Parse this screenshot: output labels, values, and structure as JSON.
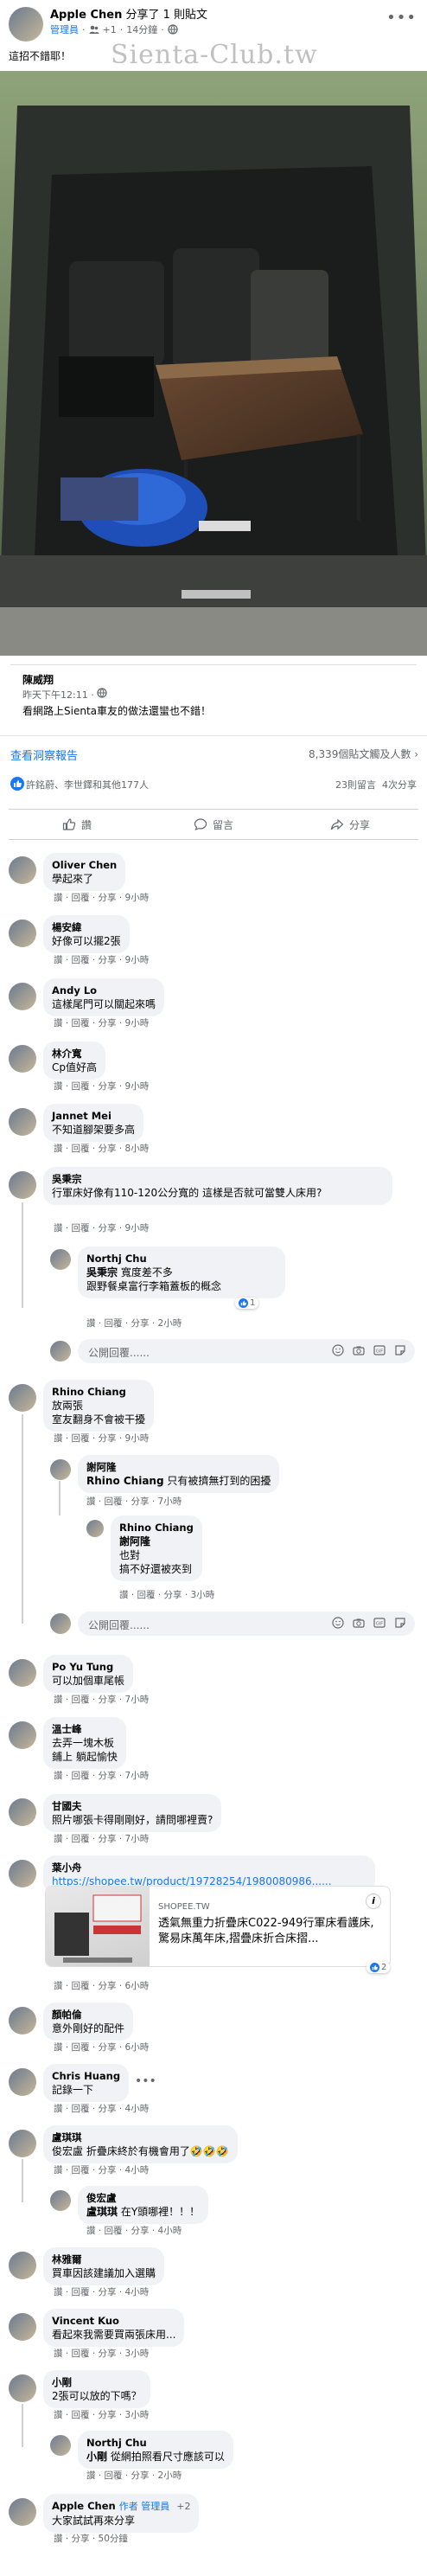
{
  "post": {
    "author": "Apple Chen",
    "action": "分享了 1 則貼文",
    "role": "管理員",
    "count_badge": "+1",
    "time": "14分鐘",
    "text": "這招不錯耶！",
    "watermark": "Sienta-Club.tw"
  },
  "shared": {
    "author": "陳威翔",
    "time": "昨天下午12:11 · ",
    "text": "看網路上Sienta車友的做法還蠻也不錯！"
  },
  "insights": {
    "link": "查看洞察報告",
    "reach": "8,339個貼文觸及人數"
  },
  "reactions": {
    "names": "許銘蔚、李世鐸和其他177人",
    "comments": "23則留言",
    "shares": "4次分享"
  },
  "actions": {
    "like": "讚",
    "comment": "留言",
    "share": "分享"
  },
  "reply_placeholder": "公開回覆......",
  "comments": [
    {
      "name": "Oliver Chen",
      "text": "學起來了",
      "meta_prefix": "讚 · 回覆 · 分享 · ",
      "time": "9小時"
    },
    {
      "name": "楊安緯",
      "text": "好像可以擺2張",
      "meta_prefix": "讚 · 回覆 · 分享 · ",
      "time": "9小時"
    },
    {
      "name": "Andy Lo",
      "text": "這樣尾門可以關起來嗎",
      "meta_prefix": "讚 · 回覆 · 分享 · ",
      "time": "9小時"
    },
    {
      "name": "林介寬",
      "text": "Cp值好高",
      "meta_prefix": "讚 · 回覆 · 分享 · ",
      "time": "9小時"
    },
    {
      "name": "Jannet Mei",
      "text": "不知道腳架要多高",
      "meta_prefix": "讚 · 回覆 · 分享 · ",
      "time": "8小時"
    },
    {
      "name": "吳秉宗",
      "text": "行軍床好像有110-120公分寬的 這樣是否就可當雙人床用?",
      "meta_prefix": "讚 · 回覆 · 分享 · ",
      "time": "9小時"
    },
    {
      "name": "Rhino Chiang",
      "text": "放兩張\n室友翻身不會被干擾",
      "meta_prefix": "讚 · 回覆 · 分享 · ",
      "time": "9小時"
    },
    {
      "name": "Po Yu Tung",
      "text": "可以加個車尾帳",
      "meta_prefix": "讚 · 回覆 · 分享 · ",
      "time": "7小時"
    },
    {
      "name": "溫士峰",
      "text": "去弄一塊木板\n鋪上 躺起愉快",
      "meta_prefix": "讚 · 回覆 · 分享 · ",
      "time": "7小時"
    },
    {
      "name": "甘國夫",
      "text": "照片哪張卡得剛剛好，請問哪裡賣?",
      "meta_prefix": "讚 · 回覆 · 分享 · ",
      "time": "7小時"
    },
    {
      "name": "葉小舟",
      "text": "https://shopee.tw/product/19728254/1980080986......",
      "meta_prefix": "讚 · 回覆 · 分享 · ",
      "time": "6小時"
    },
    {
      "name": "顏帕倫",
      "text": "意外剛好的配件",
      "meta_prefix": "讚 · 回覆 · 分享 · ",
      "time": "6小時"
    },
    {
      "name": "Chris Huang",
      "text": "記錄一下",
      "meta_prefix": "讚 · 回覆 · 分享 · ",
      "time": "4小時"
    },
    {
      "name": "盧琪琪",
      "text": "俊宏盧 折疊床終於有機會用了🤣🤣🤣",
      "meta_prefix": "讚 · 回覆 · 分享 · ",
      "time": "4小時"
    },
    {
      "name": "林雅爾",
      "text": "買車因該建議加入選購",
      "meta_prefix": "讚 · 回覆 · 分享 · ",
      "time": "4小時"
    },
    {
      "name": "Vincent Kuo",
      "text": "看起來我需要買兩張床用...",
      "meta_prefix": "讚 · 回覆 · 分享 · ",
      "time": "3小時"
    },
    {
      "name": "小剛",
      "text": "2張可以放的下嗎？",
      "meta_prefix": "讚 · 回覆 · 分享 · ",
      "time": "3小時"
    },
    {
      "name": "Apple Chen",
      "badges": "作者   管理員",
      "count": "+2",
      "text": "大家試試再來分享",
      "meta_prefix": "讚 · 分享 · ",
      "time": "50分鐘"
    }
  ],
  "replies": {
    "northju1": {
      "name": "Northj Chu",
      "mention": "吳秉宗",
      "text1": " 寬度差不多",
      "text2": "跟野餐桌富行李箱蓋板的概念",
      "meta_prefix": "讚 · 回覆 · 分享 · ",
      "time": "2小時",
      "react_count": "1"
    },
    "xie": {
      "name": "謝阿隆",
      "mention": "Rhino Chiang",
      "text": " 只有被擠無打到的困擾",
      "meta_prefix": "讚 · 回覆 · 分享 · ",
      "time": "7小時"
    },
    "rhino2": {
      "name": "Rhino Chiang",
      "mention": "謝阿隆",
      "text": "也對\n搞不好還被夾到",
      "meta_prefix": "讚 · 回覆 · 分享 · ",
      "time": "3小時"
    },
    "jun": {
      "name": "俊宏盧",
      "mention": "盧琪琪",
      "text": " 在Y頭哪裡！！！",
      "meta_prefix": "讚 · 回覆 · 分享 · ",
      "time": "4小時"
    },
    "northju2": {
      "name": "Northj Chu",
      "mention": "小剛",
      "text": " 從網拍照看尺寸應該可以",
      "meta_prefix": "讚 · 回覆 · 分享 · ",
      "time": "2小時"
    }
  },
  "link_preview": {
    "domain": "SHOPEE.TW",
    "title": "透氣無重力折疊床C022-949行軍床看護床,驚易床萬年床,摺疊床折合床摺...",
    "react_count": "2"
  },
  "colors": {
    "accent": "#1877f2",
    "bubble": "#f0f2f5",
    "muted": "#65676b"
  }
}
